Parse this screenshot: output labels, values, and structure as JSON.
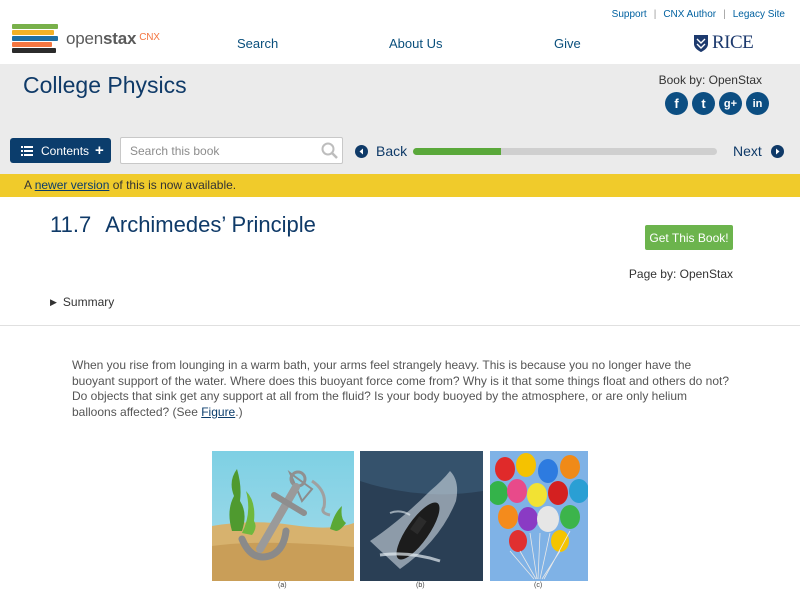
{
  "brand": {
    "name_light": "open",
    "name_bold": "stax",
    "suffix": "CNX"
  },
  "utility_links": [
    "Support",
    "CNX Author",
    "Legacy Site"
  ],
  "nav": [
    "Search",
    "About Us",
    "Give"
  ],
  "partner": "RICE",
  "book": {
    "title": "College Physics",
    "book_by": "Book by: OpenStax"
  },
  "socials": [
    {
      "icon": "facebook-icon",
      "glyph": "f"
    },
    {
      "icon": "twitter-icon",
      "glyph": "t"
    },
    {
      "icon": "google-plus-icon",
      "glyph": "g+"
    },
    {
      "icon": "linkedin-icon",
      "glyph": "in"
    }
  ],
  "toolbar": {
    "contents_label": "Contents",
    "search_placeholder": "Search this book",
    "back_label": "Back",
    "next_label": "Next",
    "progress_fraction": 0.29
  },
  "notice": {
    "prefix": "A ",
    "link": "newer version",
    "suffix": " of this is now available."
  },
  "page": {
    "number": "11.7",
    "title": "Archimedes’ Principle",
    "get_book_label": "Get This Book!",
    "page_by": "Page by: OpenStax",
    "summary_label": "Summary",
    "intro_text": "When you rise from lounging in a warm bath, your arms feel strangely heavy. This is because you no longer have the buoyant support of the water. Where does this buoyant force come from? Why is it that some things float and others do not? Do objects that sink get any support at all from the fluid? Is your body buoyed by the atmosphere, or are only helium balloons affected? (See ",
    "intro_link": "Figure",
    "intro_end": ".)"
  },
  "figure": {
    "captions": [
      "(a)",
      "(b)",
      "(c)"
    ]
  },
  "colors": {
    "brand_blue": "#0f3a68",
    "accent_green": "#6cb44d",
    "notice_yellow": "#f0cb2b",
    "progress_green": "#5aa83a"
  }
}
